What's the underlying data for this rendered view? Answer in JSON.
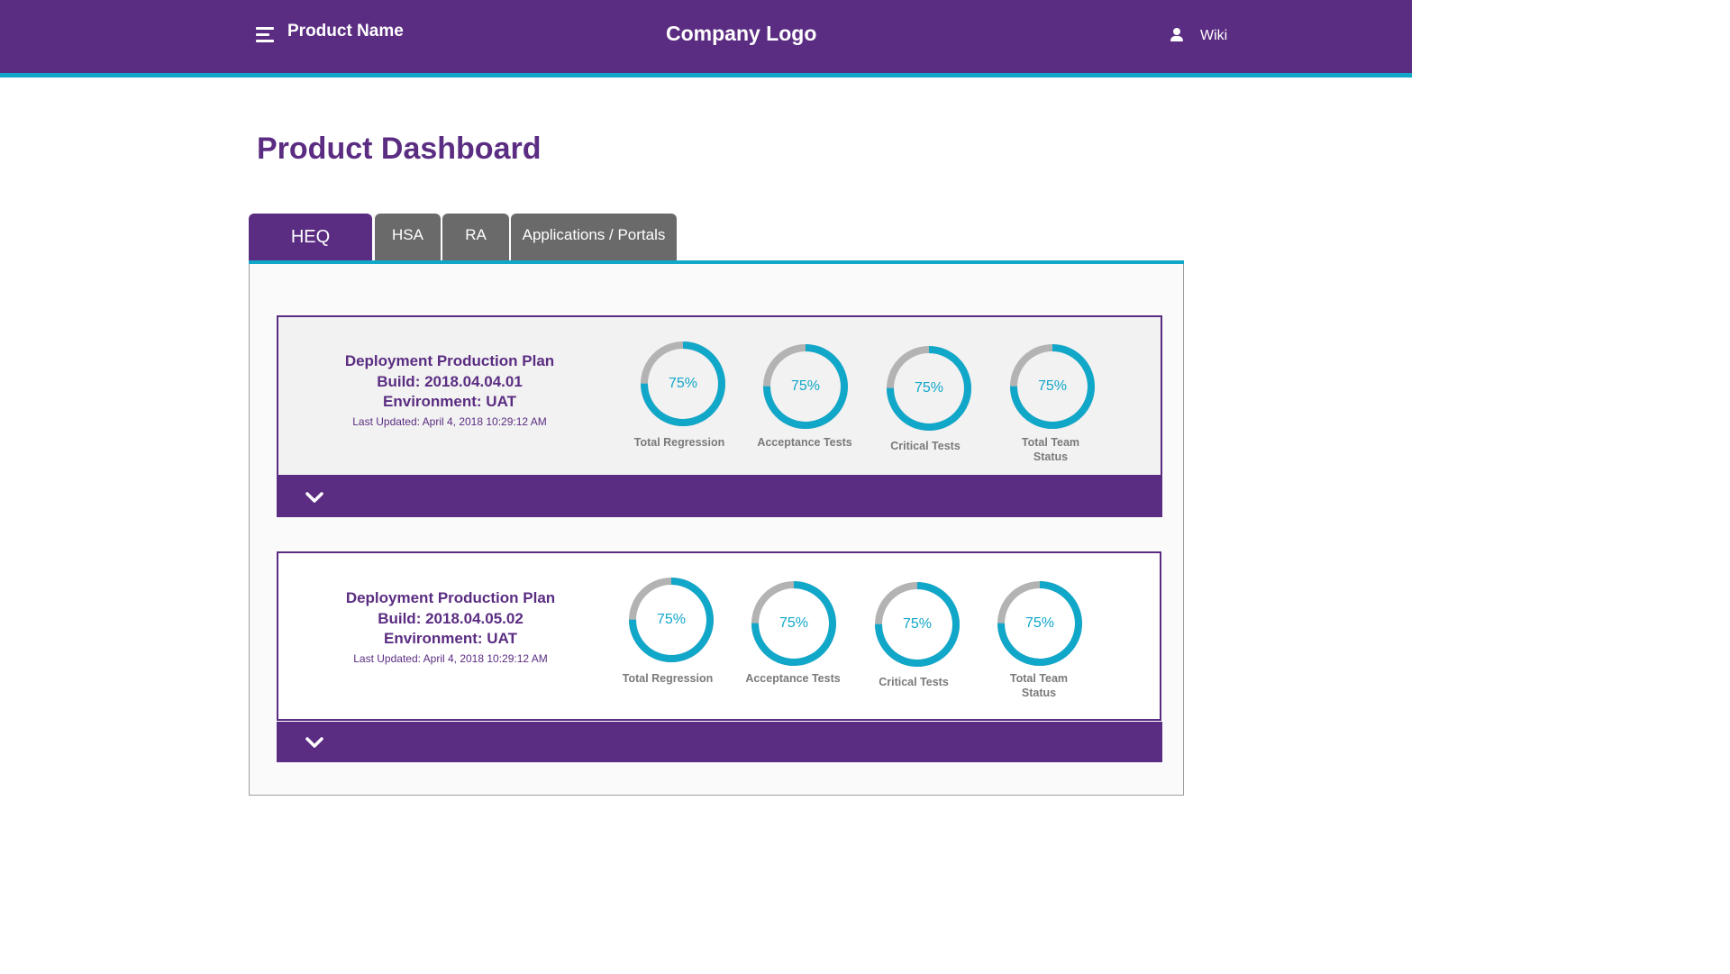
{
  "header": {
    "product_name": "Product Name",
    "company_logo": "Company Logo",
    "wiki_label": "Wiki",
    "menu_icon": "hamburger-menu-icon",
    "user_icon": "user-icon"
  },
  "page": {
    "title": "Product Dashboard"
  },
  "tabs": [
    {
      "label": "HEQ",
      "active": true
    },
    {
      "label": "HSA",
      "active": false
    },
    {
      "label": "RA",
      "active": false
    },
    {
      "label": "Applications / Portals",
      "active": false
    }
  ],
  "cards": [
    {
      "plan_title": "Deployment Production Plan",
      "build": "Build: 2018.04.04.01",
      "environment": "Environment: UAT",
      "last_updated": "Last Updated: April 4, 2018 10:29:12 AM",
      "metrics": [
        {
          "value_label": "75%",
          "progress": 0.75,
          "label": "Total Regression"
        },
        {
          "value_label": "75%",
          "progress": 0.75,
          "label": "Acceptance Tests"
        },
        {
          "value_label": "75%",
          "progress": 0.75,
          "label": "Critical Tests"
        },
        {
          "value_label": "75%",
          "progress": 0.75,
          "label": "Total Team Status"
        }
      ]
    },
    {
      "plan_title": "Deployment Production Plan",
      "build": "Build: 2018.04.05.02",
      "environment": "Environment: UAT",
      "last_updated": "Last Updated: April 4, 2018 10:29:12 AM",
      "metrics": [
        {
          "value_label": "75%",
          "progress": 0.75,
          "label": "Total Regression"
        },
        {
          "value_label": "75%",
          "progress": 0.75,
          "label": "Acceptance Tests"
        },
        {
          "value_label": "75%",
          "progress": 0.75,
          "label": "Critical Tests"
        },
        {
          "value_label": "75%",
          "progress": 0.75,
          "label": "Total Team Status"
        }
      ]
    }
  ],
  "colors": {
    "brand_purple": "#5b2d82",
    "accent_teal": "#11a7c9",
    "ring_track_gray": "#b3b3b3",
    "tab_inactive_gray": "#6a6a6a"
  }
}
